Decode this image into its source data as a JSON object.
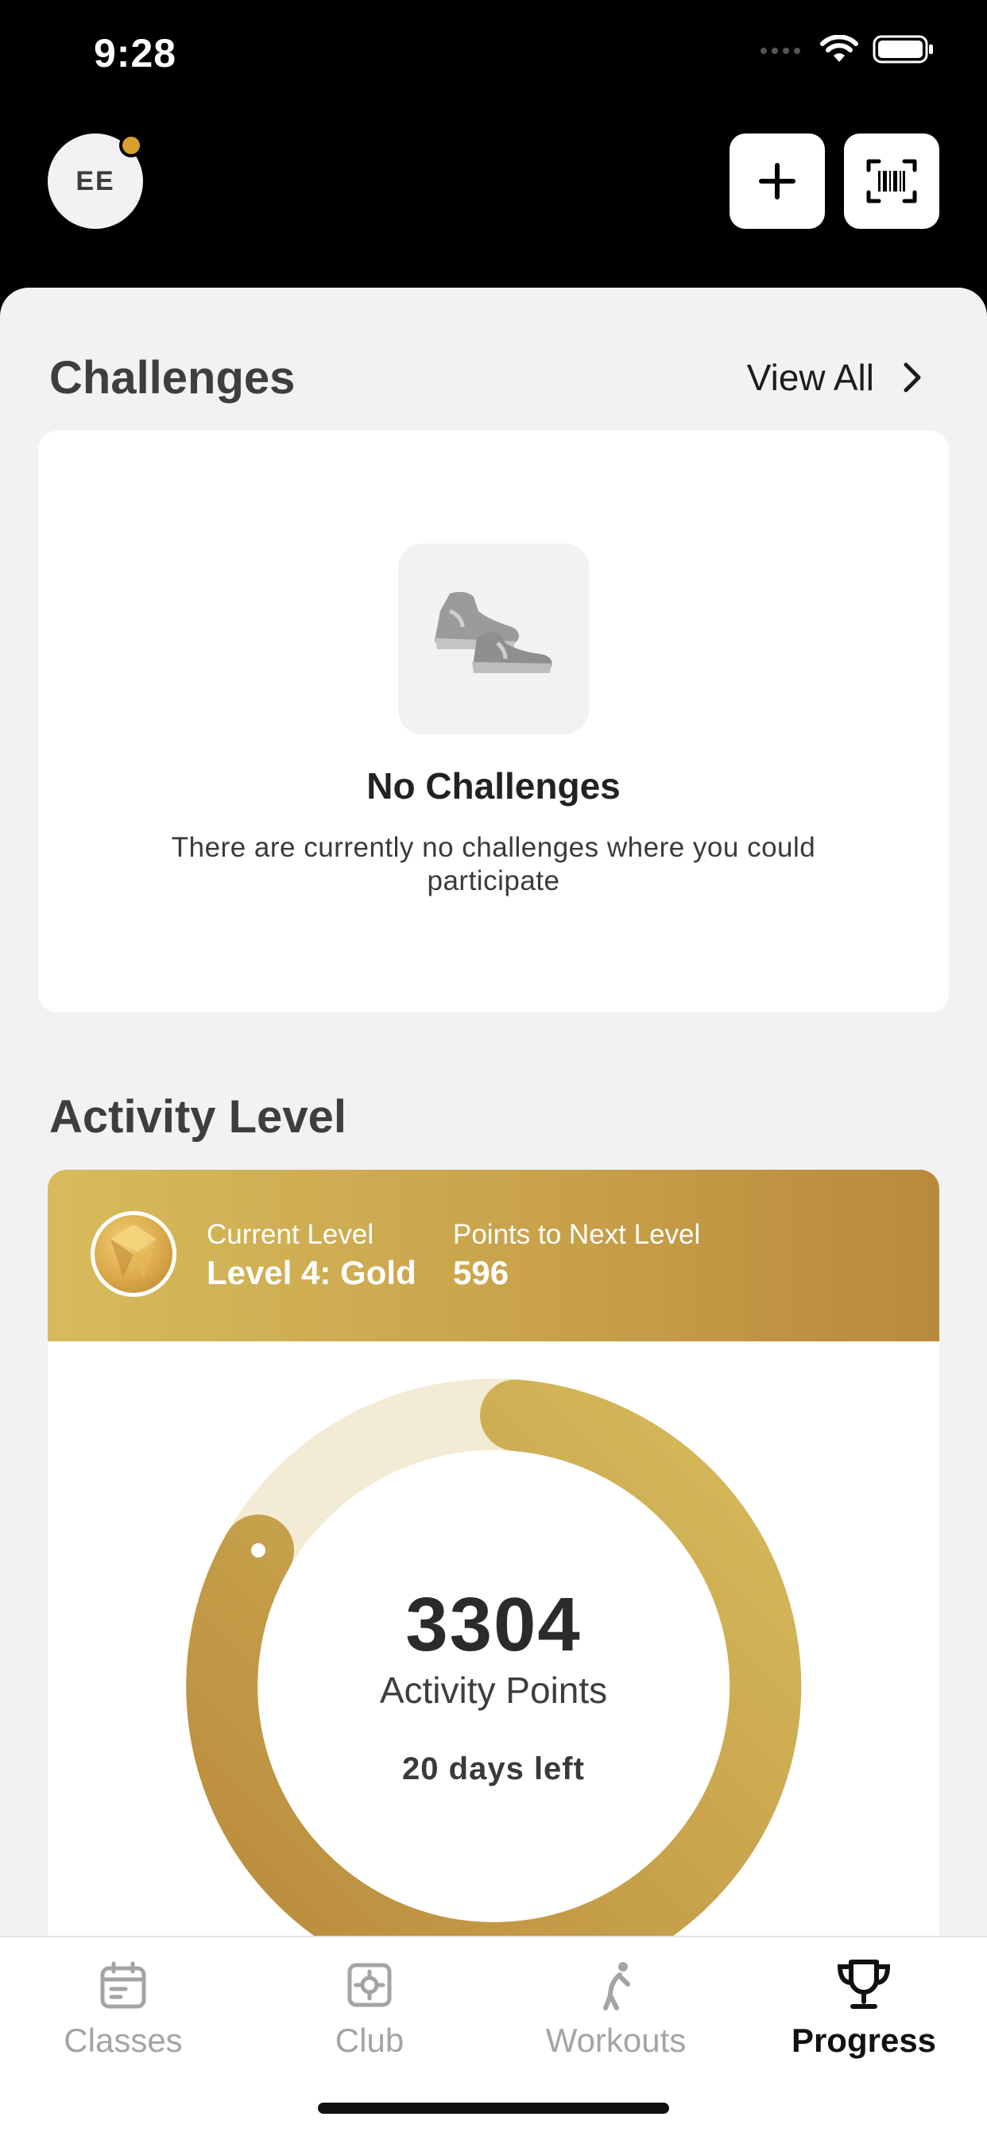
{
  "status_bar": {
    "time": "9:28"
  },
  "header": {
    "avatar_initials": "EE",
    "add_icon": "plus-icon",
    "scan_icon": "barcode-scan-icon"
  },
  "challenges": {
    "title": "Challenges",
    "view_all": "View All",
    "empty_title": "No Challenges",
    "empty_desc": "There are currently no challenges where you could participate",
    "empty_icon": "shoes-icon"
  },
  "activity": {
    "title": "Activity Level",
    "current_level_label": "Current Level",
    "current_level_value": "Level 4: Gold",
    "next_level_label": "Points to Next Level",
    "next_level_value": "596",
    "points": "3304",
    "points_label": "Activity Points",
    "days_left": "20 days left",
    "ring_colors": {
      "track": "#f3ebd4",
      "start": "#b98a3c",
      "end": "#d6bb5c"
    }
  },
  "tabs": [
    {
      "label": "Classes",
      "icon": "calendar-icon",
      "active": false
    },
    {
      "label": "Club",
      "icon": "club-icon",
      "active": false
    },
    {
      "label": "Workouts",
      "icon": "workout-figure-icon",
      "active": false
    },
    {
      "label": "Progress",
      "icon": "trophy-icon",
      "active": true
    }
  ]
}
